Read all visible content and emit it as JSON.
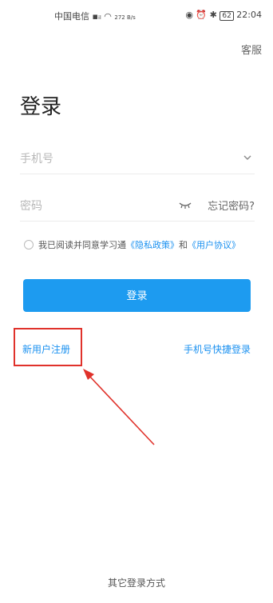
{
  "status_bar": {
    "carrier": "中国电信",
    "net_speed": "272 B/s",
    "battery": "62",
    "time": "22:04"
  },
  "header": {
    "customer_service": "客服"
  },
  "login": {
    "title": "登录",
    "phone_placeholder": "手机号",
    "password_placeholder": "密码",
    "forgot_password": "忘记密码?",
    "agreement_text": "我已阅读并同意学习通",
    "privacy_policy": "《隐私政策》",
    "and": "和",
    "user_agreement": "《用户协议》",
    "submit": "登录"
  },
  "links": {
    "register": "新用户注册",
    "quick_login": "手机号快捷登录"
  },
  "footer": {
    "other_login": "其它登录方式"
  },
  "colors": {
    "accent": "#1d9bf0",
    "highlight": "#e0322b"
  }
}
